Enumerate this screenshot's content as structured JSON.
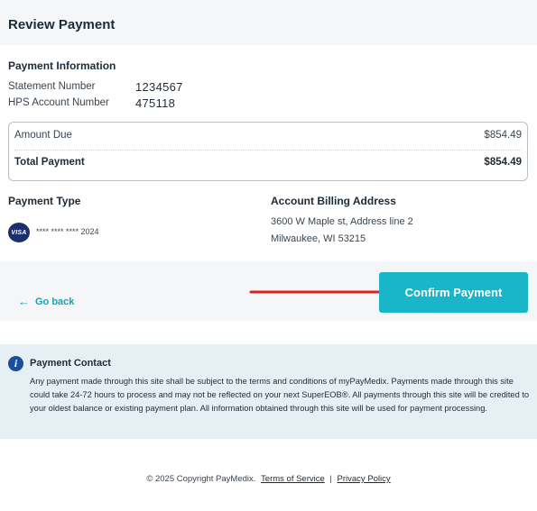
{
  "header": {
    "title": "Review Payment"
  },
  "payment_info": {
    "title": "Payment Information",
    "statement_label": "Statement Number",
    "statement_value": "1234567",
    "account_label": "HPS Account Number",
    "account_value": "475118"
  },
  "amounts": {
    "amount_due_label": "Amount Due",
    "amount_due_value": "$854.49",
    "total_label": "Total Payment",
    "total_value": "$854.49"
  },
  "payment_type": {
    "title": "Payment Type",
    "card_brand": "VISA",
    "card_number": "**** **** **** 2024"
  },
  "billing": {
    "title": "Account Billing Address",
    "line1": "3600 W Maple st, Address line 2",
    "line2": "Milwaukee, WI 53215"
  },
  "actions": {
    "go_back": "Go back",
    "confirm": "Confirm Payment"
  },
  "contact": {
    "title": "Payment Contact",
    "text": "Any payment made through this site shall be subject to the terms and  conditions of myPayMedix. Payments made through this site could take 24-72 hours to process and may not be reflected on your  next SuperEOB®. All payments through this site will be credited to your oldest balance or existing payment plan. All  information obtained through this site will be used for payment processing."
  },
  "footer": {
    "copyright": "© 2025 Copyright PayMedix.",
    "terms": "Terms of Service",
    "separator": "|",
    "privacy": "Privacy Policy"
  },
  "colors": {
    "accent": "#19b5c9",
    "link": "#16a3b8",
    "info_bg": "#e6eff4",
    "annotation_arrow": "#e0201b"
  }
}
